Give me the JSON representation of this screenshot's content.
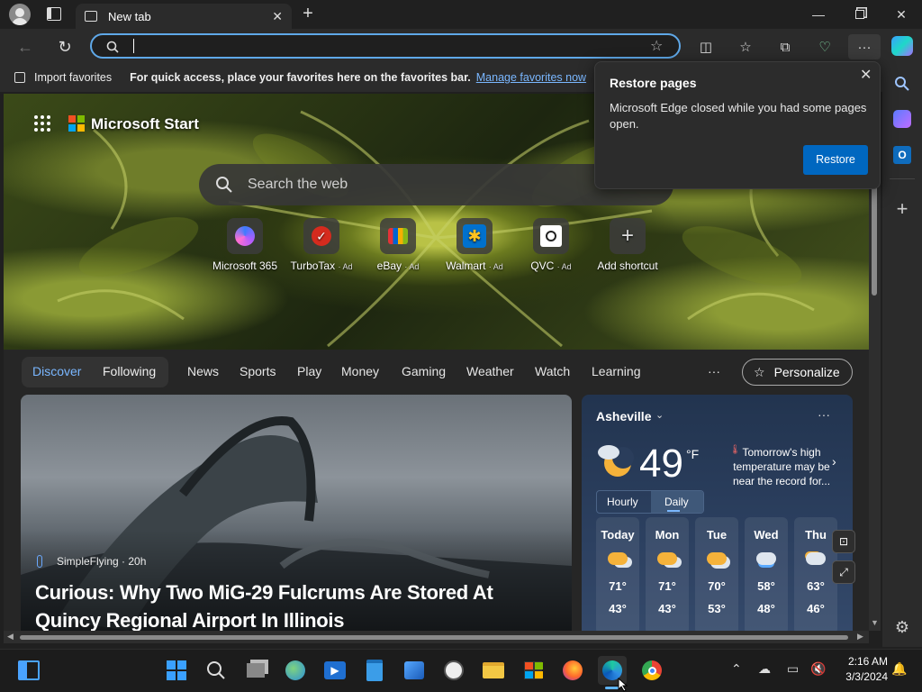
{
  "browser": {
    "tab_title": "New tab",
    "address_value": "",
    "address_placeholder": ""
  },
  "favbar": {
    "import_label": "Import favorites",
    "hint": "For quick access, place your favorites here on the favorites bar.",
    "manage_link": "Manage favorites now"
  },
  "start": {
    "brand": "Microsoft Start",
    "search_placeholder": "Search the web"
  },
  "shortcuts": [
    {
      "label": "Microsoft 365",
      "ad": ""
    },
    {
      "label": "TurboTax",
      "ad": "· Ad"
    },
    {
      "label": "eBay",
      "ad": "· Ad"
    },
    {
      "label": "Walmart",
      "ad": "· Ad"
    },
    {
      "label": "QVC",
      "ad": "· Ad"
    },
    {
      "label": "Add shortcut",
      "ad": ""
    }
  ],
  "feed_tabs": {
    "discover": "Discover",
    "following": "Following",
    "items": [
      "News",
      "Sports",
      "Play",
      "Money",
      "Gaming",
      "Weather",
      "Watch",
      "Learning"
    ],
    "more": "···",
    "personalize": "Personalize"
  },
  "story": {
    "source": "SimpleFlying · 20h",
    "headline": "Curious: Why Two MiG-29 Fulcrums Are Stored At Quincy Regional Airport In Illinois"
  },
  "weather": {
    "city": "Asheville",
    "temp": "49",
    "unit": "°F",
    "note": "Tomorrow's high temperature may be near the record for...",
    "tab_hourly": "Hourly",
    "tab_daily": "Daily",
    "days": [
      {
        "name": "Today",
        "high": "71°",
        "low": "43°"
      },
      {
        "name": "Mon",
        "high": "71°",
        "low": "43°"
      },
      {
        "name": "Tue",
        "high": "70°",
        "low": "53°"
      },
      {
        "name": "Wed",
        "high": "58°",
        "low": "48°"
      },
      {
        "name": "Thu",
        "high": "63°",
        "low": "46°"
      }
    ]
  },
  "popup": {
    "title": "Restore pages",
    "body": "Microsoft Edge closed while you had some pages open.",
    "button": "Restore"
  },
  "clock": {
    "time": "2:16 AM",
    "date": "3/3/2024"
  },
  "colors": {
    "accent": "#0067c0",
    "link": "#7ab7ff"
  }
}
